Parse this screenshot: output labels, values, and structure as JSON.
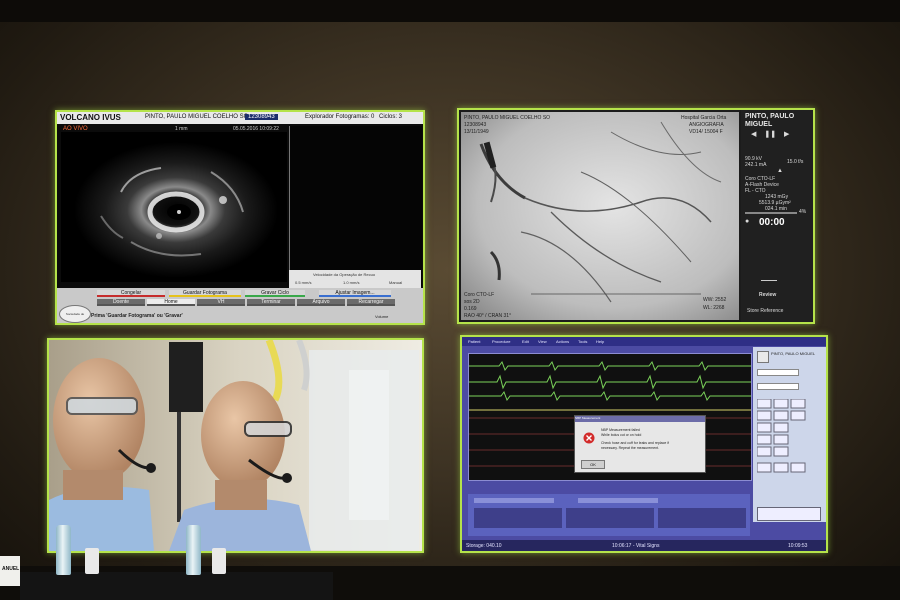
{
  "ivus": {
    "brand": "VOLCANO IVUS",
    "patient_name": "PINTO, PAULO MIGUEL COELHO SO",
    "patient_id": "12308943",
    "frame_browser": "Explorador Fotogramas: 0",
    "cycles": "Ciclos: 3",
    "live": "AO VIVO",
    "scale": "1 mm",
    "datetime": "05.05.2016 10:09:22",
    "speed_title": "Velocidade da Operação de Recuo",
    "speed_options": [
      "0.5 mm/s",
      "1.0 mm/s",
      "Manual"
    ],
    "row1_buttons": [
      "Congelar",
      "Guardar Fotograma",
      "Gravar Ciclo",
      "Ajustar Imagem..."
    ],
    "row2_buttons": [
      "Doente",
      "Home",
      "VH",
      "Terminar",
      "Arquivo",
      "Recarregar"
    ],
    "prompt": "Prima 'Guardar Fotograma' ou 'Gravar'",
    "volume": "Volume",
    "logo": "Sociedade de Cardiologia"
  },
  "angio": {
    "patient_name": "PINTO, PAULO MIGUEL",
    "top_left": [
      "PINTO, PAULO MIGUEL COELHO SO",
      "12308943",
      "13/11/1949"
    ],
    "top_right": [
      "Hospital Garcia Orta",
      "ANGIOGRAFIA",
      "VD14/ 15004 F"
    ],
    "bottom_left": [
      "Coro CTO-LF",
      "sos 2D",
      "0.169",
      "RAO 40° / CRAN 31°"
    ],
    "bottom_right": [
      "WW: 2552",
      "WL: 2268"
    ],
    "kv": "90.9 kV",
    "ma": "242.1 mA",
    "fps": "15.0 f/s",
    "protocol": [
      "Coro CTO-LF",
      "A-Flash Device",
      "FL - CTO"
    ],
    "dose": [
      "1243 mGy",
      "5513.9 µGym²",
      "024.1 min"
    ],
    "percent": "4%",
    "timer": "00:00",
    "review": "Review",
    "store_reference": "Store Reference"
  },
  "vitals": {
    "menu": [
      "Patient",
      "Procedure",
      "Edit",
      "View",
      "Actions",
      "Tools",
      "Help"
    ],
    "patient_name": "PINTO, PAULO MIGUEL",
    "dialog_title": "NBP Measurement",
    "dialog_lines": [
      "NBP Measurement failed",
      "While bolus cut or on hold",
      "Check hose and cuff for leaks and replace if",
      "necessary. Repeat the measurement."
    ],
    "ok_label": "OK",
    "storage": "Storage: 040.10",
    "center_status": "10:06:17 - Vital Signs",
    "clock": "10:09:53"
  },
  "namecard": "ANUEL"
}
